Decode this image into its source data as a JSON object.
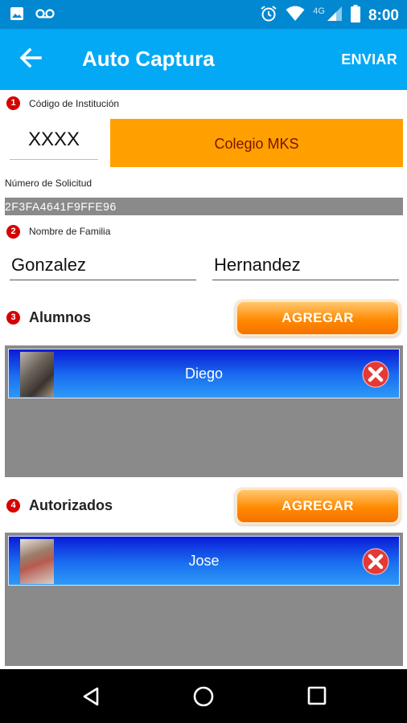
{
  "status_bar": {
    "time": "8:00",
    "network": "4G",
    "icons": [
      "image-icon",
      "voicemail-icon",
      "alarm-icon",
      "wifi-icon",
      "signal-icon",
      "battery-icon"
    ]
  },
  "app_bar": {
    "title": "Auto Captura",
    "action_label": "ENVIAR",
    "color": "#03a9f4",
    "status_color": "#0288d1"
  },
  "institution": {
    "step": "1",
    "label": "Código de Institución",
    "code": "XXXX",
    "name": "Colegio MKS",
    "color": "#ffa000"
  },
  "request": {
    "label": "Número de Solicitud",
    "value": "2F3FA4641F9FFE96"
  },
  "family": {
    "step": "2",
    "label": "Nombre de Familia",
    "first_surname": "Gonzalez",
    "second_surname": "Hernandez"
  },
  "students": {
    "step": "3",
    "label": "Alumnos",
    "add_label": "AGREGAR",
    "items": [
      {
        "name": "Diego"
      }
    ]
  },
  "authorized": {
    "step": "4",
    "label": "Autorizados",
    "add_label": "AGREGAR",
    "items": [
      {
        "name": "Jose"
      }
    ]
  },
  "nav_bar": {
    "buttons": [
      "back-nav-icon",
      "home-nav-icon",
      "recents-nav-icon"
    ]
  }
}
